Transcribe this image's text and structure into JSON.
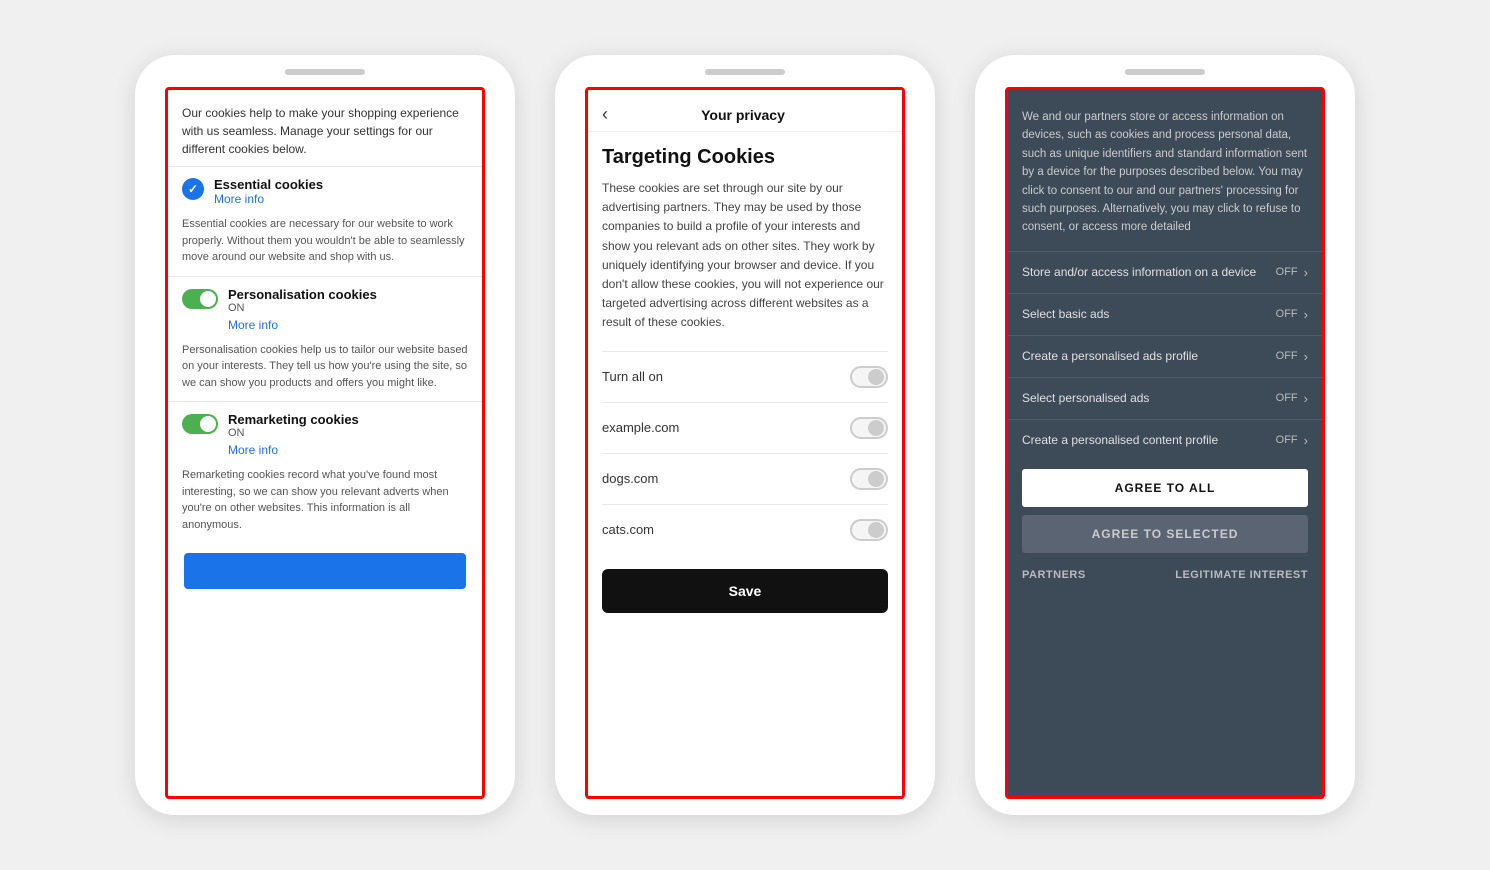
{
  "phone1": {
    "top_text": "Our cookies help to make your shopping experience with us seamless. Manage your settings for our different cookies below.",
    "sections": [
      {
        "id": "essential",
        "icon": "check",
        "title": "Essential cookies",
        "more_info": "More info",
        "description": "Essential cookies are necessary for our website to work properly. Without them you wouldn't be able to seamlessly move around our website and shop with us."
      },
      {
        "id": "personalisation",
        "icon": "toggle-on",
        "on_label": "ON",
        "title": "Personalisation cookies",
        "more_info": "More info",
        "description": "Personalisation cookies help us to tailor our website based on your interests. They tell us how you're using the site, so we can show you products and offers you might like."
      },
      {
        "id": "remarketing",
        "icon": "toggle-on",
        "on_label": "ON",
        "title": "Remarketing cookies",
        "more_info": "More info",
        "description": "Remarketing cookies record what you've found most interesting, so we can show you relevant adverts when you're on other websites. This information is all anonymous."
      }
    ]
  },
  "phone2": {
    "back_label": "‹",
    "header_title": "Your privacy",
    "section_title": "Targeting Cookies",
    "description": "These cookies are set through our site by our advertising partners. They may be used by those companies to build a profile of your interests and show you relevant ads on other sites. They work by uniquely identifying your browser and device. If you don't allow these cookies, you will not experience our targeted advertising across different websites as a result of these cookies.",
    "toggles": [
      {
        "label": "Turn all on"
      },
      {
        "label": "example.com"
      },
      {
        "label": "dogs.com"
      },
      {
        "label": "cats.com"
      }
    ],
    "save_button": "Save"
  },
  "phone3": {
    "top_text": "We and our partners store or access information on devices, such as cookies and process personal data, such as unique identifiers and standard information sent by a device for the purposes described below. You may click to consent to our and our partners' processing for such purposes. Alternatively, you may click to refuse to consent, or access more detailed",
    "rows": [
      {
        "label": "Store and/or access information on a device",
        "status": "OFF"
      },
      {
        "label": "Select basic ads",
        "status": "OFF"
      },
      {
        "label": "Create a personalised ads profile",
        "status": "OFF"
      },
      {
        "label": "Select personalised ads",
        "status": "OFF"
      },
      {
        "label": "Create a personalised content profile",
        "status": "OFF"
      }
    ],
    "agree_all_button": "AGREE TO ALL",
    "agree_selected_button": "AGREE TO SELECTED",
    "footer_left": "PARTNERS",
    "footer_right": "LEGITIMATE INTEREST"
  }
}
